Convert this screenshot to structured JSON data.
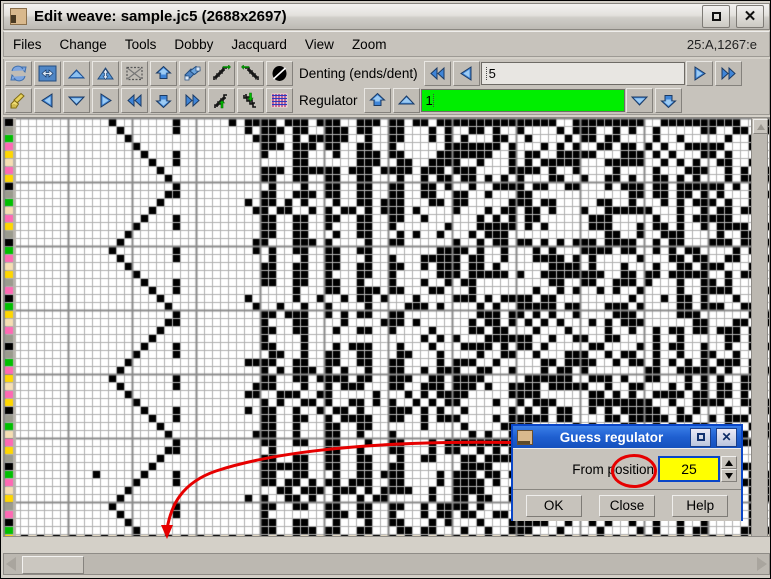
{
  "window": {
    "title": "Edit weave: sample.jc5 (2688x2697)",
    "icon": "app-icon",
    "maximize_label": "□",
    "close_label": "✕"
  },
  "menubar": {
    "items": [
      {
        "label": "Files"
      },
      {
        "label": "Change"
      },
      {
        "label": "Tools"
      },
      {
        "label": "Dobby"
      },
      {
        "label": "Jacquard"
      },
      {
        "label": "View"
      },
      {
        "label": "Zoom"
      }
    ],
    "status": "25:A,1267:e"
  },
  "toolbar_row1": {
    "buttons": [
      {
        "name": "refresh-icon"
      },
      {
        "name": "flip-horizontal-icon"
      },
      {
        "name": "collapse-up-icon"
      },
      {
        "name": "expand-vertical-icon"
      },
      {
        "name": "clear-selection-icon"
      },
      {
        "name": "move-up-icon"
      },
      {
        "name": "copy-layers-icon"
      },
      {
        "name": "twill-right-icon"
      },
      {
        "name": "twill-left-icon"
      },
      {
        "name": "invert-icon"
      }
    ],
    "field_label": "Denting (ends/dent)",
    "nav": [
      {
        "name": "first-icon"
      },
      {
        "name": "previous-icon"
      }
    ],
    "field_value": "5",
    "nav_right": [
      {
        "name": "next-icon"
      },
      {
        "name": "last-icon"
      }
    ]
  },
  "toolbar_row2": {
    "buttons": [
      {
        "name": "broom-icon"
      },
      {
        "name": "left-icon"
      },
      {
        "name": "down-icon"
      },
      {
        "name": "right-icon"
      },
      {
        "name": "rewind-icon"
      },
      {
        "name": "move-down-icon"
      },
      {
        "name": "fast-forward-icon"
      },
      {
        "name": "twill-up-icon"
      },
      {
        "name": "twill-down-icon"
      },
      {
        "name": "texture-icon"
      }
    ],
    "field_label": "Regulator",
    "nav": [
      {
        "name": "top-icon"
      },
      {
        "name": "up-icon"
      }
    ],
    "field_value": "1",
    "field_color": "#00ee00",
    "nav_right": [
      {
        "name": "down-small-icon"
      },
      {
        "name": "bottom-icon"
      }
    ]
  },
  "dialog": {
    "title": "Guess regulator",
    "icon": "dialog-icon",
    "maximize_label": "□",
    "close_label": "✕",
    "field_label": "From position",
    "field_value": "25",
    "field_bg": "#ffff00",
    "buttons": [
      {
        "label": "OK"
      },
      {
        "label": "Close"
      },
      {
        "label": "Help"
      }
    ]
  },
  "annotation": {
    "color": "#e60000",
    "kind": "curved-arrow"
  },
  "palette": {
    "colors": [
      "#000000",
      "#9b9b8e",
      "#00c000",
      "#ff69b4",
      "#ffd700",
      "#f5deb3"
    ]
  },
  "weave": {
    "cell_size": 8,
    "bg": "#ffffff",
    "ink": "#000000",
    "gridline": "#b0b0b0",
    "major_gridline": "#8a8a8a",
    "major_every": 8
  }
}
